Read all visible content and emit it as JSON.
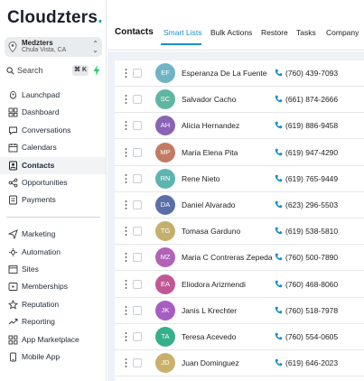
{
  "brand": {
    "logo_text": "Cloudzters",
    "logo_dot": ".",
    "accent": "#17a2b8"
  },
  "account": {
    "name": "Medzters",
    "location": "Chula Vista, CA"
  },
  "search": {
    "label": "Search",
    "shortcut": "⌘ K"
  },
  "sidebar": {
    "items": [
      {
        "label": "Launchpad",
        "icon": "rocket-icon"
      },
      {
        "label": "Dashboard",
        "icon": "grid-icon"
      },
      {
        "label": "Conversations",
        "icon": "chat-icon"
      },
      {
        "label": "Calendars",
        "icon": "calendar-icon"
      },
      {
        "label": "Contacts",
        "icon": "contacts-icon",
        "active": true
      },
      {
        "label": "Opportunities",
        "icon": "filter-icon"
      },
      {
        "label": "Payments",
        "icon": "payments-icon"
      },
      {
        "label": "Marketing",
        "icon": "send-icon"
      },
      {
        "label": "Automation",
        "icon": "automation-icon"
      },
      {
        "label": "Sites",
        "icon": "sites-icon"
      },
      {
        "label": "Memberships",
        "icon": "memberships-icon"
      },
      {
        "label": "Reputation",
        "icon": "star-icon"
      },
      {
        "label": "Reporting",
        "icon": "trend-icon"
      },
      {
        "label": "App Marketplace",
        "icon": "apps-icon"
      },
      {
        "label": "Mobile App",
        "icon": "mobile-icon"
      }
    ]
  },
  "header": {
    "title": "Contacts",
    "tabs": [
      {
        "label": "Smart Lists",
        "active": true
      },
      {
        "label": "Bulk Actions"
      },
      {
        "label": "Restore"
      },
      {
        "label": "Tasks"
      },
      {
        "label": "Company"
      }
    ]
  },
  "contacts": [
    {
      "initials": "EF",
      "name": "Esperanza De La Fuente",
      "phone": "(760) 439-7093",
      "color": "#6fb3c4"
    },
    {
      "initials": "SC",
      "name": "Salvador Cacho",
      "phone": "(661) 874-2666",
      "color": "#5fb6a1"
    },
    {
      "initials": "AH",
      "name": "Alicia Hernandez",
      "phone": "(619) 886-9458",
      "color": "#8a63b5"
    },
    {
      "initials": "MP",
      "name": "Maria Elena Pita",
      "phone": "(619) 947-4290",
      "color": "#c27b63"
    },
    {
      "initials": "RN",
      "name": "Rene Nieto",
      "phone": "(619) 765-9449",
      "color": "#5db4b0"
    },
    {
      "initials": "DA",
      "name": "Daniel Alvarado",
      "phone": "(623) 296-5503",
      "color": "#5a6fa8"
    },
    {
      "initials": "TG",
      "name": "Tomasa Garduno",
      "phone": "(619) 538-5810",
      "color": "#c2b06e"
    },
    {
      "initials": "MZ",
      "name": "Maria C Contreras Zepeda",
      "phone": "(760) 500-7890",
      "color": "#b162b7"
    },
    {
      "initials": "EA",
      "name": "Eliodora Arizmendi",
      "phone": "(760) 468-8060",
      "color": "#c35796"
    },
    {
      "initials": "JK",
      "name": "Janis L Krechter",
      "phone": "(760) 518-7978",
      "color": "#a65ec1"
    },
    {
      "initials": "TA",
      "name": "Teresa Acevedo",
      "phone": "(760) 554-0605",
      "color": "#35b08a"
    },
    {
      "initials": "JD",
      "name": "Juan Dominguez",
      "phone": "(619) 646-2023",
      "color": "#c9b06b"
    }
  ]
}
